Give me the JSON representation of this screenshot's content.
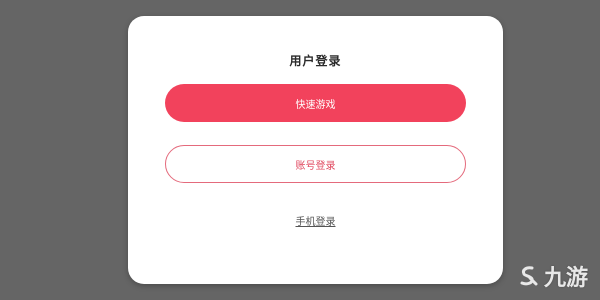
{
  "dialog": {
    "title": "用户登录",
    "quick_play_label": "快速游戏",
    "account_login_label": "账号登录",
    "phone_login_label": "手机登录"
  },
  "colors": {
    "overlay": "#656565",
    "primary": "#f2425c",
    "outline": "#e46a7c"
  },
  "watermark": {
    "text": "九游",
    "icon": "jiuyou-logo-icon"
  }
}
